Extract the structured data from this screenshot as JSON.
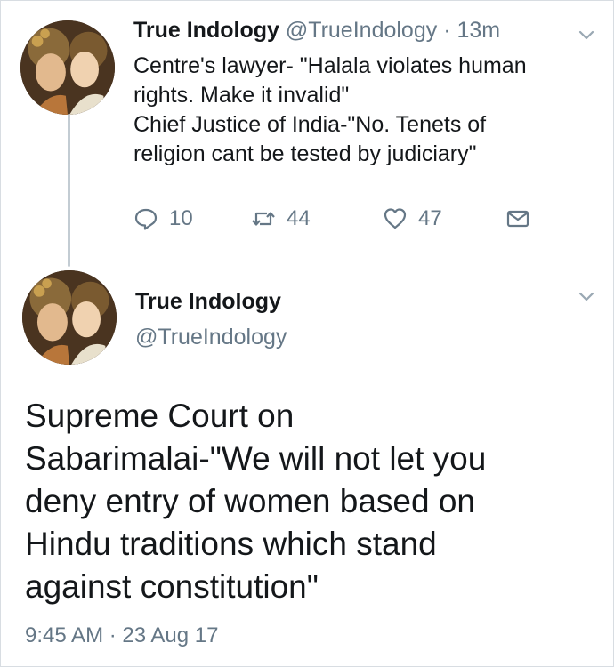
{
  "tweet1": {
    "name": "True Indology",
    "handle": "@TrueIndology",
    "separator": "·",
    "time": "13m",
    "lines": [
      "Centre's lawyer- \"Halala violates human",
      "rights. Make it invalid\"",
      "Chief Justice of India-\"No. Tenets of",
      "religion cant be tested by judiciary\""
    ],
    "replies": "10",
    "retweets": "44",
    "likes": "47",
    "icons": {
      "reply": "reply-icon",
      "retweet": "retweet-icon",
      "like": "heart-icon",
      "message": "envelope-icon",
      "menu": "chevron-down-icon"
    }
  },
  "tweet2": {
    "name": "True Indology",
    "handle": "@TrueIndology",
    "lines": [
      "Supreme Court on",
      "Sabarimalai-\"We will not let you",
      "deny entry of women based on",
      "Hindu traditions which stand",
      "against constitution\""
    ],
    "timestamp": "9:45 AM · 23 Aug 17"
  },
  "colors": {
    "text": "#14171a",
    "secondary": "#657786",
    "thread_line": "#c3ccd3"
  }
}
